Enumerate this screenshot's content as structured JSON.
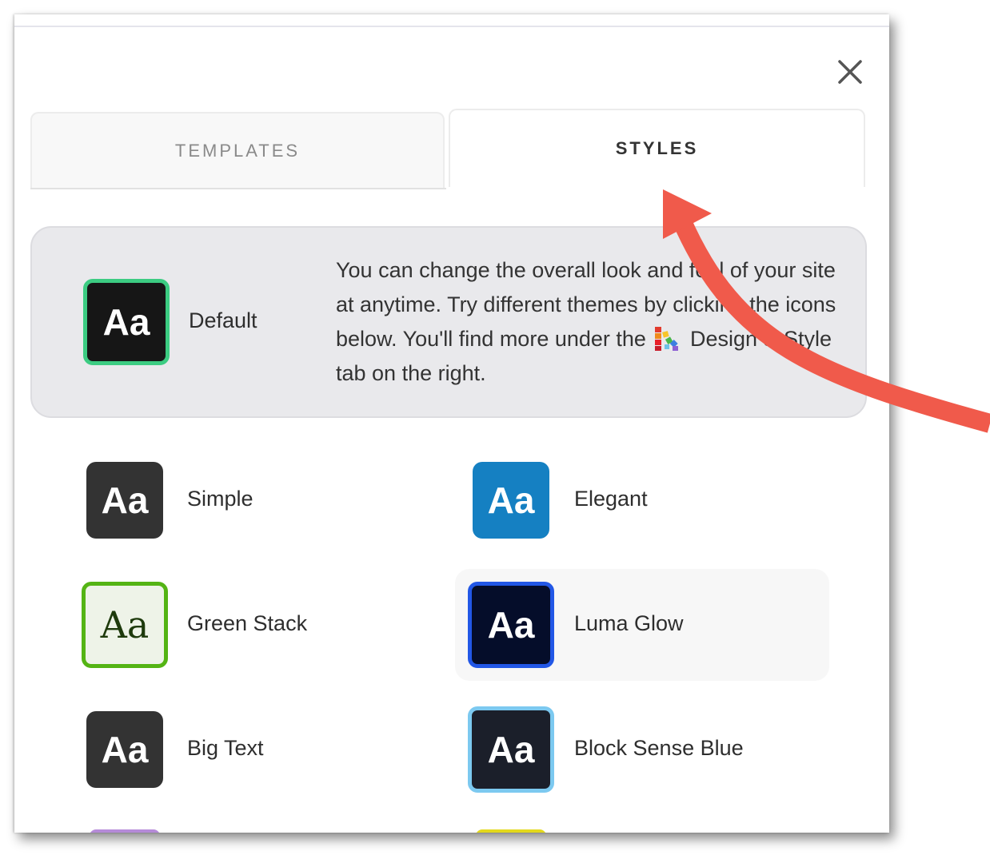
{
  "tabs": [
    {
      "label": "TEMPLATES",
      "active": false
    },
    {
      "label": "STYLES",
      "active": true
    }
  ],
  "current": {
    "icon_text": "Aa",
    "name": "Default",
    "description_before": "You can change the overall look and feel of your site at anytime. Try different themes by clicking the icons below. You'll find more under the",
    "description_after": "Design & Style tab on the right."
  },
  "styles": [
    {
      "name": "Simple",
      "icon_text": "Aa",
      "bg": "#333333",
      "border": "none"
    },
    {
      "name": "Elegant",
      "icon_text": "Aa",
      "bg": "#1580c2",
      "border": "none"
    },
    {
      "name": "Green Stack",
      "icon_text": "Aa",
      "bg": "#eef3e8",
      "border": "#54b414"
    },
    {
      "name": "Luma Glow",
      "icon_text": "Aa",
      "bg": "#050d2a",
      "border": "#2257e6"
    },
    {
      "name": "Big Text",
      "icon_text": "Aa",
      "bg": "#333333",
      "border": "none"
    },
    {
      "name": "Block Sense Blue",
      "icon_text": "Aa",
      "bg": "#1b1f2a",
      "border": "#7cc9f0"
    }
  ],
  "colors": {
    "default_icon_border": "#3ccc82",
    "annotation_arrow": "#f05a4b"
  },
  "icons": [
    "close-icon",
    "palette-icon",
    "annotation-arrow"
  ]
}
